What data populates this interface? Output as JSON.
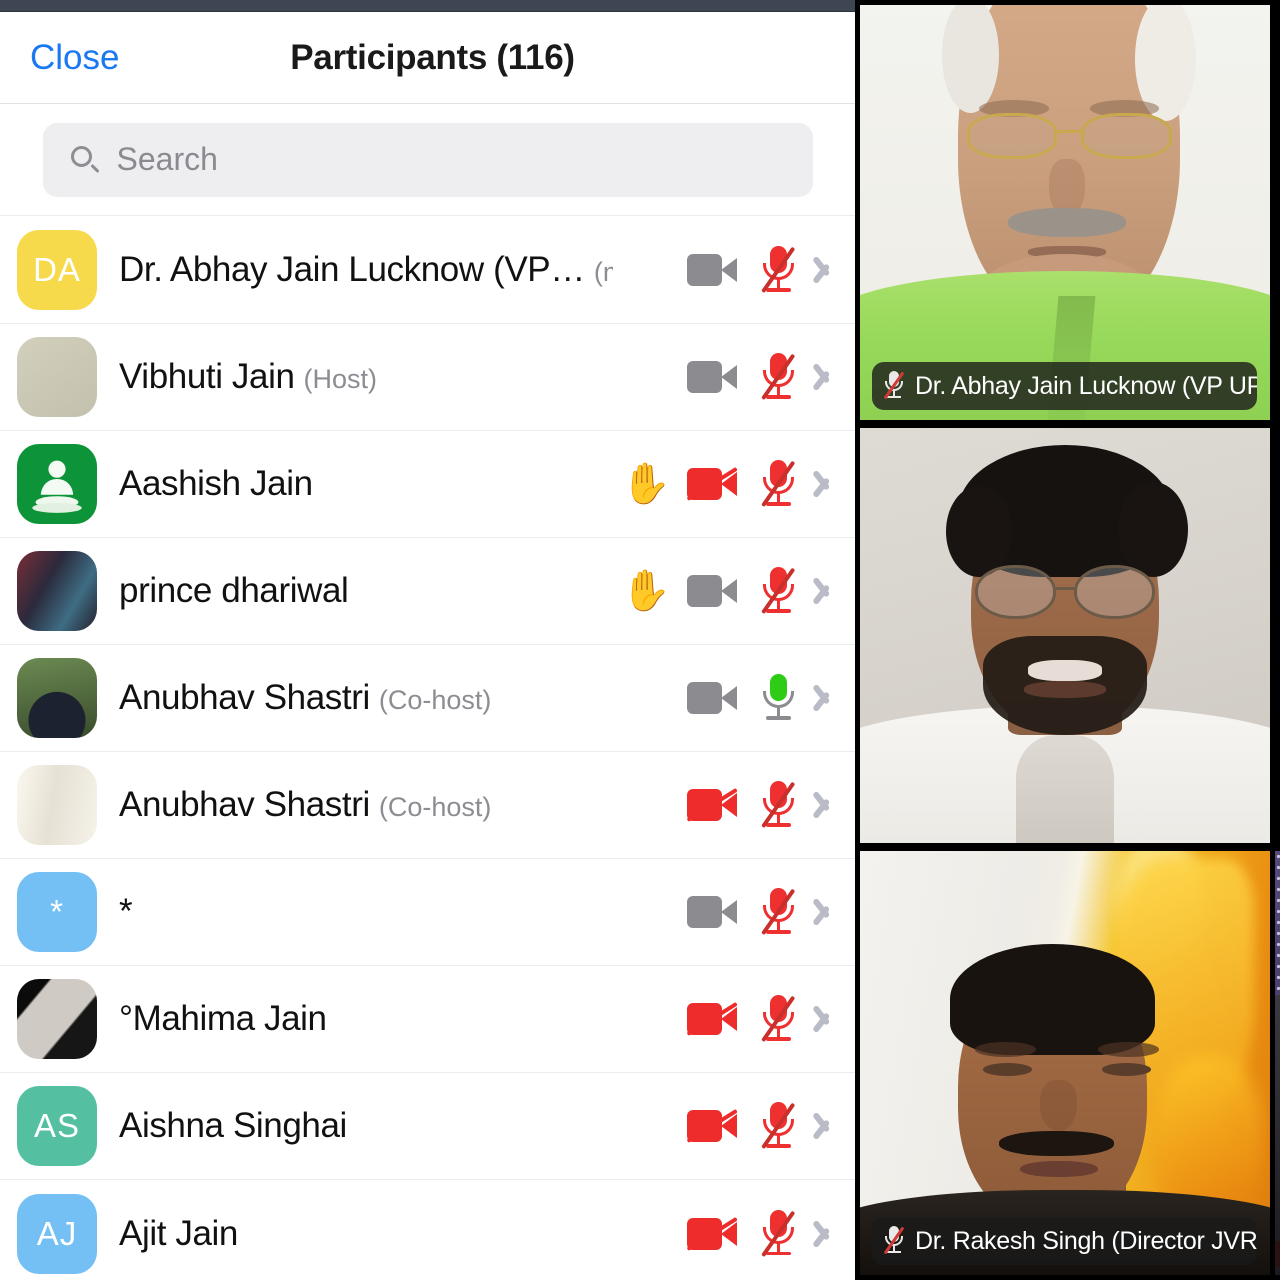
{
  "panel": {
    "close_label": "Close",
    "title": "Participants (116)",
    "search": {
      "placeholder": "Search",
      "value": "",
      "icon": "search-icon"
    },
    "participants": [
      {
        "initials": "DA",
        "avatar_color": "#f7d94c",
        "avatar_type": "initials",
        "name": "Dr. Abhay Jain Lucknow (VP…",
        "role": "(me)",
        "hand_raised": false,
        "video": "on",
        "mic": "muted"
      },
      {
        "initials": "",
        "avatar_color": "#cbc9b6",
        "avatar_type": "photo",
        "name": "Vibhuti Jain",
        "role": "(Host)",
        "hand_raised": false,
        "video": "on",
        "mic": "muted"
      },
      {
        "initials": "",
        "avatar_color": "#0e9438",
        "avatar_type": "logo",
        "name": "Aashish Jain",
        "role": "",
        "hand_raised": true,
        "video": "off",
        "mic": "muted"
      },
      {
        "initials": "",
        "avatar_color": "#2a2026",
        "avatar_type": "photo",
        "name": "prince dhariwal",
        "role": "",
        "hand_raised": true,
        "video": "on",
        "mic": "muted"
      },
      {
        "initials": "",
        "avatar_color": "#3a4a2e",
        "avatar_type": "photo",
        "name": "Anubhav Shastri",
        "role": "(Co-host)",
        "hand_raised": false,
        "video": "on",
        "mic": "live"
      },
      {
        "initials": "",
        "avatar_color": "#efeade",
        "avatar_type": "photo",
        "name": "Anubhav Shastri",
        "role": "(Co-host)",
        "hand_raised": false,
        "video": "off",
        "mic": "muted"
      },
      {
        "initials": "*",
        "avatar_color": "#74c0f5",
        "avatar_type": "initials",
        "name": "*",
        "role": "",
        "hand_raised": false,
        "video": "on",
        "mic": "muted"
      },
      {
        "initials": "",
        "avatar_color": "#1b1b1b",
        "avatar_type": "photo",
        "name": "°Mahima Jain",
        "role": "",
        "hand_raised": false,
        "video": "off",
        "mic": "muted"
      },
      {
        "initials": "AS",
        "avatar_color": "#55bfa2",
        "avatar_type": "initials",
        "name": "Aishna Singhai",
        "role": "",
        "hand_raised": false,
        "video": "off",
        "mic": "muted"
      },
      {
        "initials": "AJ",
        "avatar_color": "#74c0f5",
        "avatar_type": "initials",
        "name": "Ajit Jain",
        "role": "",
        "hand_raised": false,
        "video": "off",
        "mic": "muted"
      }
    ],
    "icons": {
      "hand_glyph": "✋",
      "camera_icon": "camera-icon",
      "mic_icon": "mic-icon",
      "chevron_icon": "chevron-right-icon"
    }
  },
  "video_tiles": [
    {
      "name": "Dr. Abhay Jain Lucknow (VP UP…",
      "mic": "muted",
      "has_badge": true
    },
    {
      "name": "",
      "mic": "muted",
      "has_badge": false
    },
    {
      "name": "Dr. Rakesh Singh (Director JVRI)",
      "mic": "muted",
      "has_badge": true
    },
    {
      "name": "",
      "mic": "muted",
      "has_badge": false
    }
  ],
  "colors": {
    "accent_blue": "#1a78f2",
    "muted_red": "#ef3030",
    "active_green": "#2fcc15",
    "icon_grey": "#8b8b90",
    "topbar": "#3f4552",
    "search_bg": "#eeeef0"
  }
}
